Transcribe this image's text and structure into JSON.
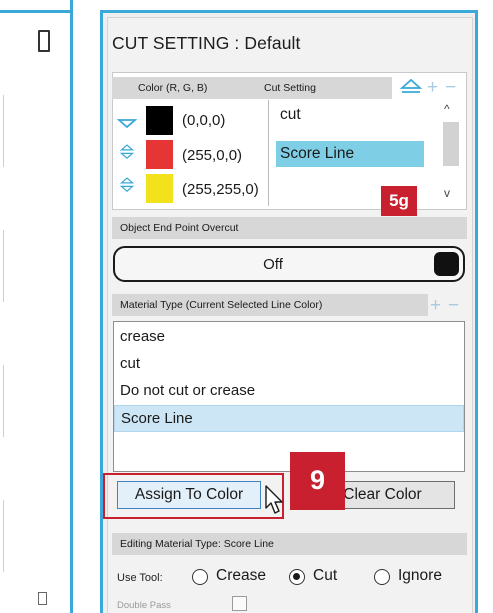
{
  "panel": {
    "title": "CUT SETTING : Default"
  },
  "color_table": {
    "col_color": "Color (R, G, B)",
    "col_cut": "Cut Setting",
    "add_symbol": "+",
    "remove_symbol": "−",
    "rows": [
      {
        "swatch": "#000000",
        "rgb": "(0,0,0)",
        "cut": "cut"
      },
      {
        "swatch": "#e53535",
        "rgb": "(255,0,0)",
        "cut": "Score Line"
      },
      {
        "swatch": "#f2e21b",
        "rgb": "(255,255,0)",
        "cut": ""
      }
    ],
    "scroll_up": "^",
    "scroll_down": "v",
    "selected_cut_color": "#7ecfe6"
  },
  "badge_5g": "5g",
  "overcut": {
    "header": "Object End Point Overcut",
    "value": "Off"
  },
  "material": {
    "header": "Material Type (Current Selected Line Color)",
    "add_symbol": "+",
    "remove_symbol": "−",
    "items": [
      "crease",
      "cut",
      "Do not cut or crease",
      "Score Line"
    ],
    "selected": "Score Line"
  },
  "buttons": {
    "assign": "Assign To Color",
    "clear": "Clear Color"
  },
  "callout": "9",
  "editing": {
    "label": "Editing  Material Type: Score Line"
  },
  "tool": {
    "label": "Use Tool:",
    "options": [
      "Crease",
      "Cut",
      "Ignore"
    ],
    "selected": "Cut"
  },
  "double_pass": {
    "label": "Double Pass"
  },
  "colors": {
    "accent": "#3aa8d8",
    "badge": "#c8202f",
    "selection": "#cde6f6"
  }
}
